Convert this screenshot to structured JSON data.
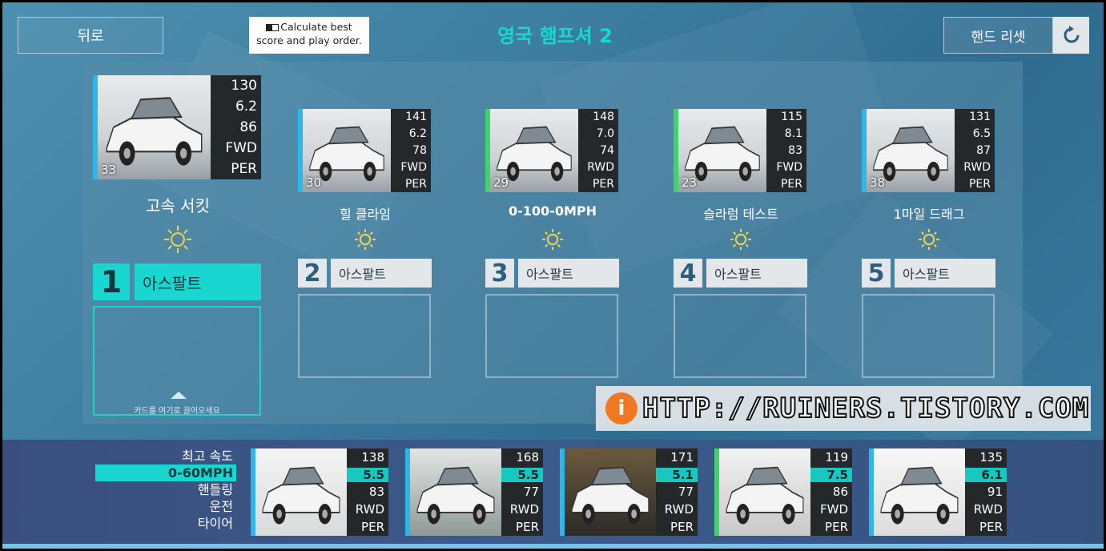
{
  "header": {
    "back_label": "뒤로",
    "calc_label": "Calculate best score and play order.",
    "event_title": "영국 햄프셔 2",
    "reset_label": "핸드 리셋"
  },
  "slots": [
    {
      "index": "1",
      "event": "고속 서킷",
      "surface": "아스팔트",
      "weather": "sun-icon",
      "drop_hint": "카드를 여기로 끌어오세요",
      "card": {
        "rq": "33",
        "stats": [
          "130",
          "6.2",
          "86",
          "FWD",
          "PER"
        ],
        "tone": "blue"
      }
    },
    {
      "index": "2",
      "event": "힐 클라임",
      "surface": "아스팔트",
      "weather": "sun-icon",
      "card": {
        "rq": "30",
        "stats": [
          "141",
          "6.2",
          "78",
          "FWD",
          "PER"
        ],
        "tone": "blue"
      }
    },
    {
      "index": "3",
      "event": "0-100-0MPH",
      "surface": "아스팔트",
      "weather": "sun-icon",
      "card": {
        "rq": "29",
        "stats": [
          "148",
          "7.0",
          "74",
          "RWD",
          "PER"
        ],
        "tone": "green"
      }
    },
    {
      "index": "4",
      "event": "슬라럼 테스트",
      "surface": "아스팔트",
      "weather": "sun-icon",
      "card": {
        "rq": "23",
        "stats": [
          "115",
          "8.1",
          "83",
          "FWD",
          "PER"
        ],
        "tone": "green"
      }
    },
    {
      "index": "5",
      "event": "1마일 드래그",
      "surface": "아스팔트",
      "weather": "sun-icon",
      "card": {
        "rq": "38",
        "stats": [
          "131",
          "6.5",
          "87",
          "RWD",
          "PER"
        ],
        "tone": "blue"
      }
    }
  ],
  "sort": {
    "options": [
      "최고 속도",
      "0-60MPH",
      "핸들링",
      "운전",
      "타이어"
    ],
    "selected_index": 1
  },
  "hand": [
    {
      "stats": [
        "138",
        "5.5",
        "83",
        "RWD",
        "PER"
      ],
      "tone": "blue"
    },
    {
      "stats": [
        "168",
        "5.5",
        "77",
        "RWD",
        "PER"
      ],
      "tone": "blue"
    },
    {
      "stats": [
        "171",
        "5.1",
        "77",
        "RWD",
        "PER"
      ],
      "tone": "blue"
    },
    {
      "stats": [
        "119",
        "7.5",
        "86",
        "FWD",
        "PER"
      ],
      "tone": "green"
    },
    {
      "stats": [
        "135",
        "6.1",
        "91",
        "RWD",
        "PER"
      ],
      "tone": "blue"
    }
  ],
  "watermark": "HTTP://RUINERS.TISTORY.COM",
  "colors": {
    "accent": "#19d6d0",
    "blue_edge": "#2bb7e8",
    "green_edge": "#3fd36a"
  }
}
